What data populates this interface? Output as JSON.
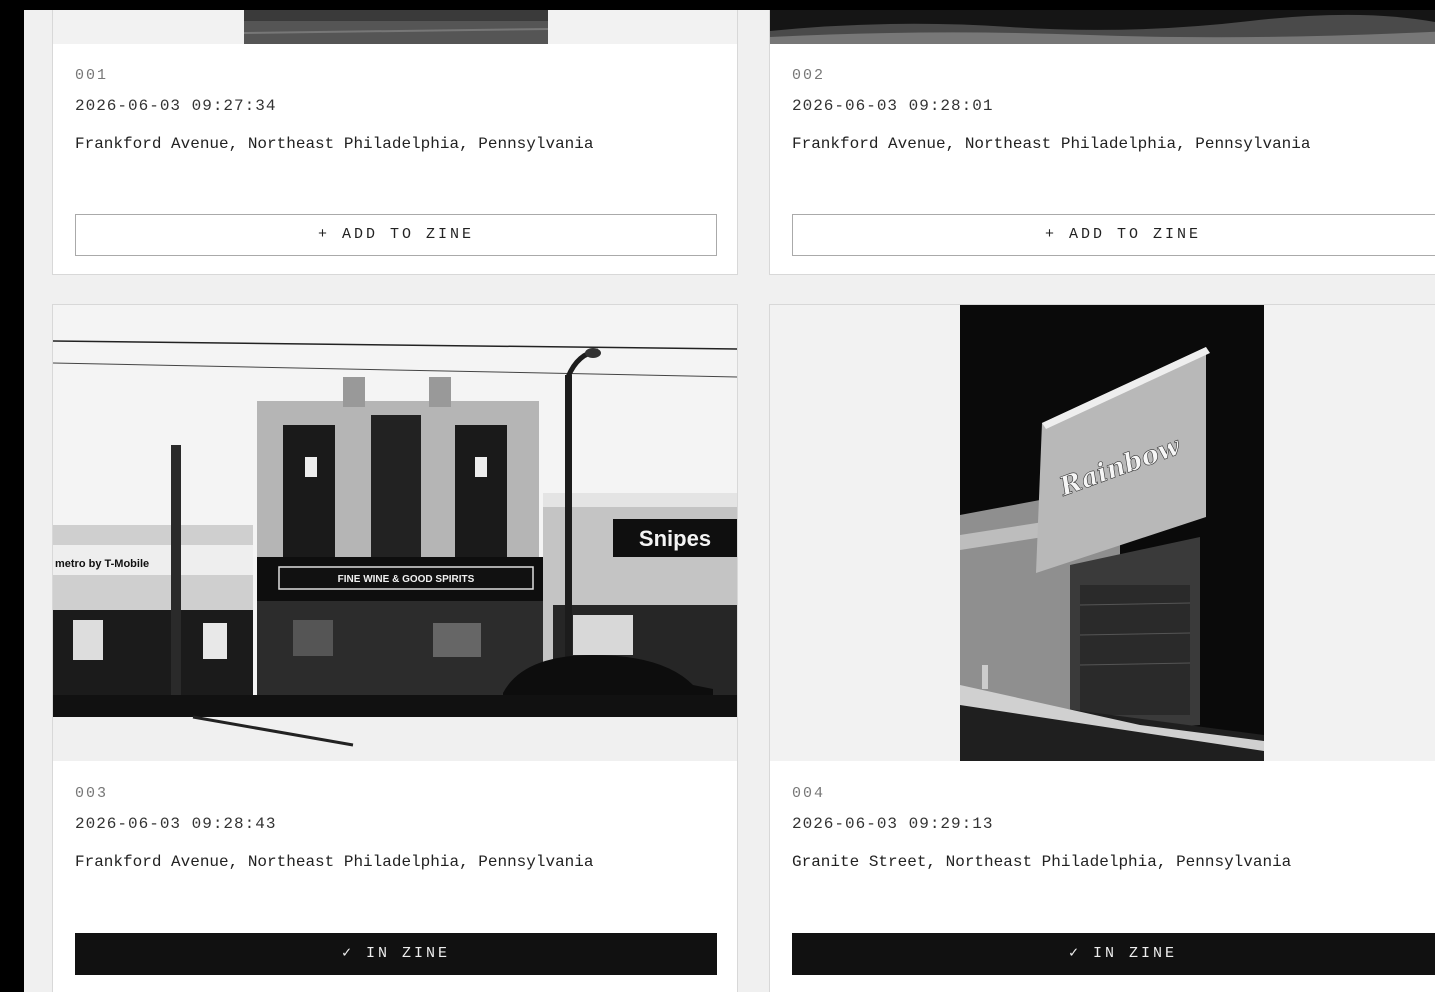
{
  "photos": [
    {
      "number": "001",
      "timestamp": "2026-06-03 09:27:34",
      "location": "Frankford Avenue, Northeast Philadelphia, Pennsylvania",
      "button_icon": "+",
      "button_label": "ADD TO ZINE",
      "in_zine": false
    },
    {
      "number": "002",
      "timestamp": "2026-06-03 09:28:01",
      "location": "Frankford Avenue, Northeast Philadelphia, Pennsylvania",
      "button_icon": "+",
      "button_label": "ADD TO ZINE",
      "in_zine": false
    },
    {
      "number": "003",
      "timestamp": "2026-06-03 09:28:43",
      "location": "Frankford Avenue, Northeast Philadelphia, Pennsylvania",
      "button_icon": "✓",
      "button_label": "IN ZINE",
      "in_zine": true,
      "image_signs": {
        "store_sign": "FINE WINE & GOOD SPIRITS",
        "right_sign": "Snipes",
        "left_sign": "metro by T-Mobile"
      }
    },
    {
      "number": "004",
      "timestamp": "2026-06-03 09:29:13",
      "location": "Granite Street, Northeast Philadelphia, Pennsylvania",
      "button_icon": "✓",
      "button_label": "IN ZINE",
      "in_zine": true,
      "image_signs": {
        "billboard": "Rainbow"
      }
    }
  ],
  "colors": {
    "page_background": "#000000",
    "card_background": "#ffffff",
    "in_zine_button": "#111111"
  }
}
